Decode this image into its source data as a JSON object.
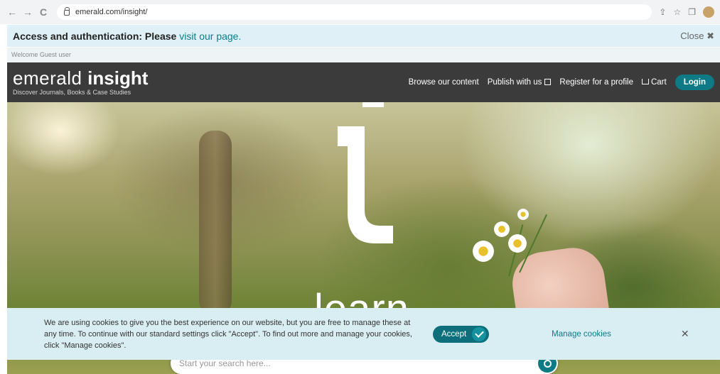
{
  "browser": {
    "url": "emerald.com/insight/",
    "back_glyph": "←",
    "forward_glyph": "→",
    "reload_glyph": "C"
  },
  "notice": {
    "text": "Access and authentication: Please ",
    "link": "visit our page.",
    "close_label": "Close ✖"
  },
  "welcome": "Welcome Guest user",
  "header": {
    "logo_light": "emerald ",
    "logo_bold": "insight",
    "tagline": "Discover Journals, Books & Case Studies",
    "nav": {
      "browse": "Browse our content",
      "publish": "Publish with us",
      "register": "Register for a profile",
      "cart": "Cart",
      "login": "Login"
    }
  },
  "hero": {
    "word": "learn",
    "search_placeholder": "Start your search here..."
  },
  "cookie": {
    "text": "We are using cookies to give you the best experience on our website, but you are free to manage these at any time. To continue with our standard settings click \"Accept\". To find out more and manage your cookies, click \"Manage cookies\".",
    "accept": "Accept",
    "manage": "Manage cookies",
    "close": "✕"
  },
  "colors": {
    "brand_teal": "#0d7a86",
    "header_bg": "#3b3b3b",
    "notice_bg": "#dff1f6"
  }
}
